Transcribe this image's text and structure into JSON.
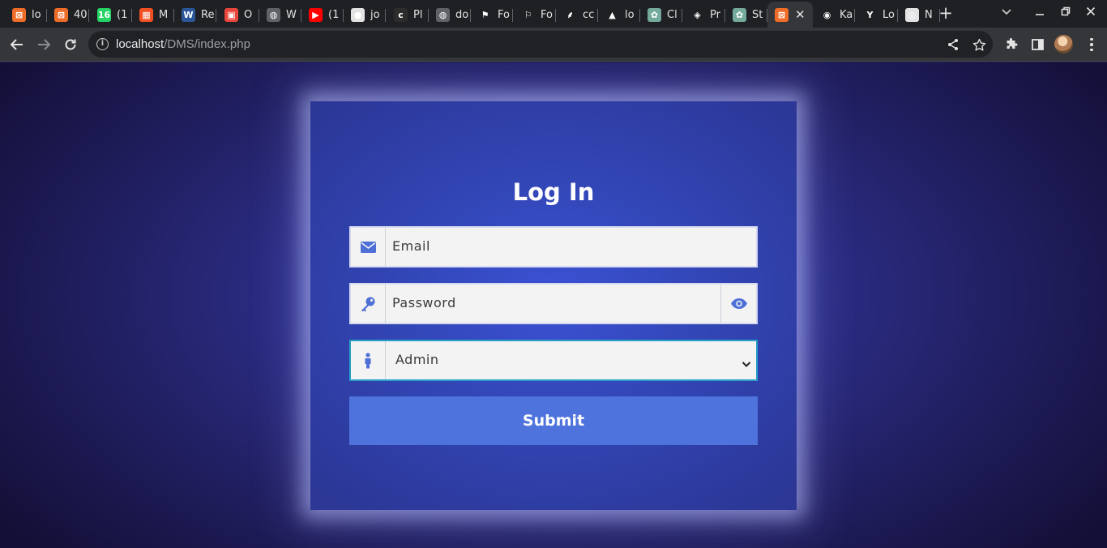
{
  "browser": {
    "tabs": [
      {
        "title": "lo",
        "favicon": "xampp-icon",
        "color": "#f06c29",
        "glyph": "⊠"
      },
      {
        "title": "40",
        "favicon": "xampp-icon",
        "color": "#f06c29",
        "glyph": "⊠"
      },
      {
        "title": "(1",
        "favicon": "whatsapp-icon",
        "color": "#25d366",
        "glyph": "16"
      },
      {
        "title": "M",
        "favicon": "microsoft-icon",
        "color": "#f25022",
        "glyph": "▦"
      },
      {
        "title": "Re",
        "favicon": "word-icon",
        "color": "#2b579a",
        "glyph": "W"
      },
      {
        "title": "O",
        "favicon": "onedrive-icon",
        "color": "#e8453c",
        "glyph": "▣"
      },
      {
        "title": "W",
        "favicon": "globe-icon",
        "color": "#5f6368",
        "glyph": "◍"
      },
      {
        "title": "(1",
        "favicon": "youtube-icon",
        "color": "#ff0000",
        "glyph": "▶"
      },
      {
        "title": "jo",
        "favicon": "github-icon",
        "color": "#e3e3e3",
        "glyph": "●"
      },
      {
        "title": "Pl",
        "favicon": "php-icon",
        "color": "#2c2c2c",
        "glyph": "c"
      },
      {
        "title": "do",
        "favicon": "globe-icon",
        "color": "#5f6368",
        "glyph": "◍"
      },
      {
        "title": "Fo",
        "favicon": "flag-icon",
        "color": "#1f2023",
        "glyph": "⚑"
      },
      {
        "title": "Fo",
        "favicon": "flag-outline-icon",
        "color": "#1f2023",
        "glyph": "⚐"
      },
      {
        "title": "cc",
        "favicon": "feather-icon",
        "color": "#1f2023",
        "glyph": "⸙"
      },
      {
        "title": "lo",
        "favicon": "laravel-icon",
        "color": "#1f2023",
        "glyph": "▲"
      },
      {
        "title": "Cl",
        "favicon": "openai-icon",
        "color": "#74aa9c",
        "glyph": "✿"
      },
      {
        "title": "Pr",
        "favicon": "drupal-icon",
        "color": "#1f2023",
        "glyph": "◈"
      },
      {
        "title": "St",
        "favicon": "openai-icon",
        "color": "#74aa9c",
        "glyph": "✿"
      },
      {
        "title": "",
        "favicon": "xampp-icon",
        "color": "#f06c29",
        "glyph": "⊠",
        "active": true
      },
      {
        "title": "Ka",
        "favicon": "kaspersky-icon",
        "color": "#1f2023",
        "glyph": "◉"
      },
      {
        "title": "Lo",
        "favicon": "yahoo-icon",
        "color": "#1f2023",
        "glyph": "Y"
      },
      {
        "title": "N",
        "favicon": "chrome-icon",
        "color": "#e3e3e3",
        "glyph": "◎"
      }
    ],
    "url_host": "localhost",
    "url_path": "/DMS/index.php"
  },
  "login": {
    "title": "Log In",
    "email_placeholder": "Email",
    "password_placeholder": "Password",
    "role_selected": "Admin",
    "submit_label": "Submit"
  },
  "colors": {
    "card": "#3246b6",
    "submit": "#4e73dc",
    "icon_accent": "#4e6fd6",
    "focus_border": "#2aa0c8"
  }
}
